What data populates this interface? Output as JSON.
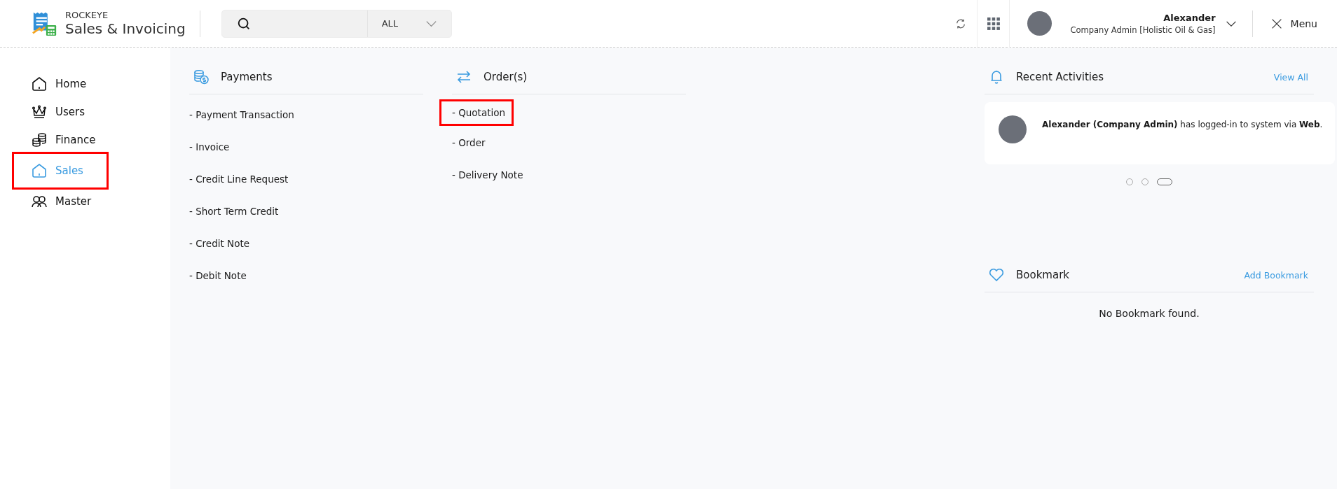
{
  "header": {
    "brand": "ROCKEYE",
    "product": "Sales & Invoicing",
    "search": {
      "scope": "ALL"
    },
    "user": {
      "name": "Alexander",
      "role": "Company Admin [Holistic Oil & Gas]"
    },
    "menu_label": "Menu"
  },
  "sidebar": {
    "items": [
      {
        "kind": "home",
        "label": "Home",
        "selected": false,
        "highlighted": false
      },
      {
        "kind": "crown",
        "label": "Users",
        "selected": false,
        "highlighted": false
      },
      {
        "kind": "coins",
        "label": "Finance",
        "selected": false,
        "highlighted": false
      },
      {
        "kind": "home",
        "label": "Sales",
        "selected": true,
        "highlighted": true
      },
      {
        "kind": "people",
        "label": "Master",
        "selected": false,
        "highlighted": false
      }
    ]
  },
  "sections": [
    {
      "kind": "payments",
      "title": "Payments",
      "items": [
        {
          "label": "- Payment Transaction",
          "highlighted": false
        },
        {
          "label": "- Invoice",
          "highlighted": false
        },
        {
          "label": "- Credit Line Request",
          "highlighted": false
        },
        {
          "label": "- Short Term Credit",
          "highlighted": false
        },
        {
          "label": "- Credit Note",
          "highlighted": false
        },
        {
          "label": "- Debit Note",
          "highlighted": false
        }
      ]
    },
    {
      "kind": "orders",
      "title": "Order(s)",
      "items": [
        {
          "label": "- Quotation",
          "highlighted": true
        },
        {
          "label": "- Order",
          "highlighted": false
        },
        {
          "label": "- Delivery Note",
          "highlighted": false
        }
      ]
    }
  ],
  "recent_activities": {
    "title": "Recent Activities",
    "action": "View All",
    "items": [
      {
        "text": "**Alexander (Company Admin)** has logged-in to system via **Web**."
      }
    ],
    "pager": [
      {
        "selected": false
      },
      {
        "selected": false
      },
      {
        "selected": true
      }
    ]
  },
  "bookmark": {
    "title": "Bookmark",
    "action": "Add Bookmark",
    "empty_text": "No Bookmark found."
  }
}
